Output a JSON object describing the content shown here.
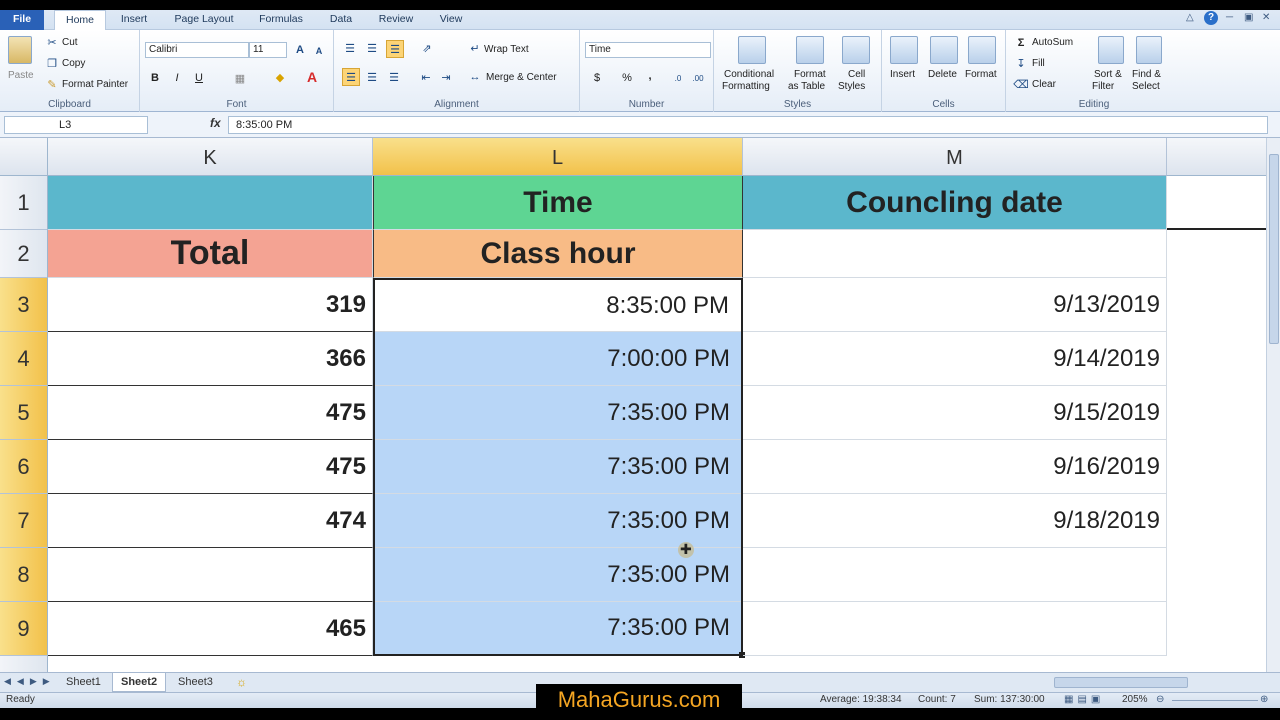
{
  "ribbon_tabs": [
    "File",
    "Home",
    "Insert",
    "Page Layout",
    "Formulas",
    "Data",
    "Review",
    "View"
  ],
  "clipboard": {
    "paste": "Paste",
    "cut": "Cut",
    "copy": "Copy",
    "format_painter": "Format Painter",
    "label": "Clipboard"
  },
  "font": {
    "name": "Calibri",
    "size": "11",
    "label": "Font",
    "bold": "B",
    "italic": "I",
    "underline": "U"
  },
  "alignment": {
    "wrap_text": "Wrap Text",
    "merge_center": "Merge & Center",
    "label": "Alignment"
  },
  "number": {
    "format": "Time",
    "currency": "$",
    "percent": "%",
    "comma": ",",
    "label": "Number"
  },
  "styles": {
    "conditional": "Conditional",
    "conditional2": "Formatting",
    "format": "Format",
    "format2": "as Table",
    "cell": "Cell",
    "cell2": "Styles",
    "label": "Styles"
  },
  "cells": {
    "insert": "Insert",
    "delete": "Delete",
    "format": "Format",
    "label": "Cells"
  },
  "editing": {
    "autosum": "AutoSum",
    "fill": "Fill",
    "clear": "Clear",
    "sort": "Sort &",
    "sort2": "Filter",
    "find": "Find &",
    "find2": "Select",
    "label": "Editing"
  },
  "formula_bar": {
    "name_box": "L3",
    "fx": "fx",
    "value": "8:35:00 PM"
  },
  "columns": [
    "K",
    "L",
    "M"
  ],
  "rows": [
    "1",
    "2",
    "3",
    "4",
    "5",
    "6",
    "7",
    "8",
    "9"
  ],
  "headers": {
    "time": "Time",
    "total": "Total",
    "class_hour": "Class hour",
    "councling": "Councling date"
  },
  "totals": [
    "319",
    "366",
    "475",
    "475",
    "474",
    "",
    "465"
  ],
  "times": [
    "8:35:00 PM",
    "7:00:00 PM",
    "7:35:00 PM",
    "7:35:00 PM",
    "7:35:00 PM",
    "7:35:00 PM",
    "7:35:00 PM"
  ],
  "dates": [
    "9/13/2019",
    "9/14/2019",
    "9/15/2019",
    "9/16/2019",
    "9/18/2019",
    "",
    ""
  ],
  "sheets": [
    "Sheet1",
    "Sheet2",
    "Sheet3"
  ],
  "status": {
    "ready": "Ready",
    "average": "Average: 19:38:34",
    "count": "Count: 7",
    "sum": "Sum: 137:30:00",
    "zoom": "205%"
  },
  "watermark": "MahaGurus.com",
  "colors": {
    "teal": "#5bb7cc",
    "green": "#5ed593",
    "salmon": "#f4a393",
    "orange": "#f8bb86",
    "selection": "#b8d6f7"
  }
}
